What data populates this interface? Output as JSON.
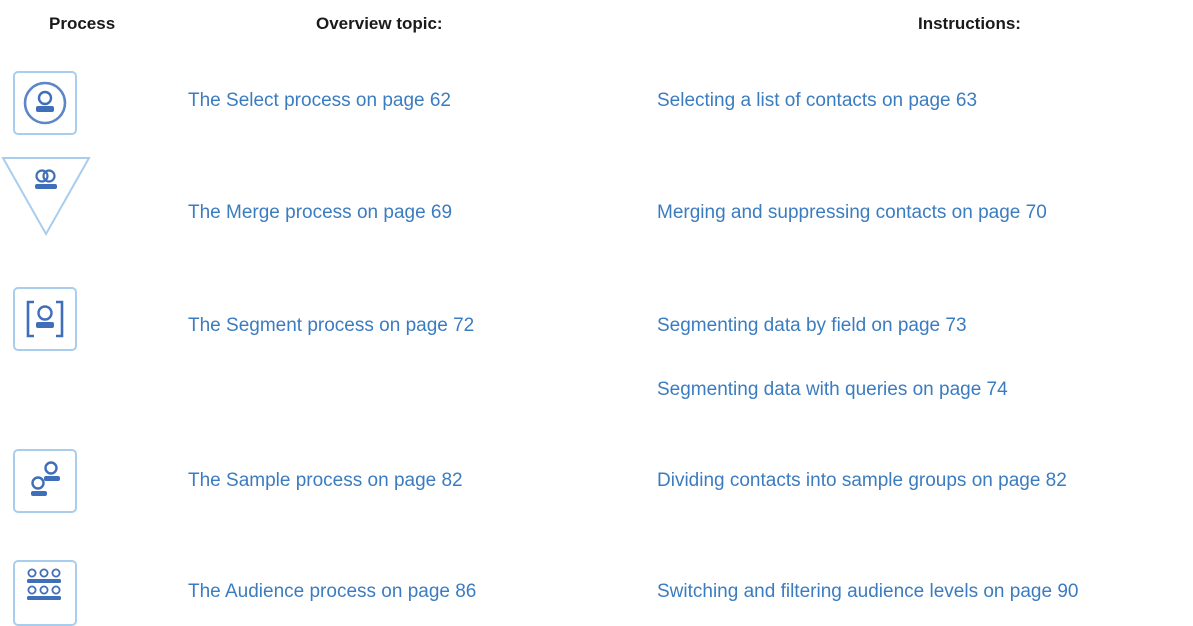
{
  "headers": {
    "process": "Process",
    "overview": "Overview topic:",
    "instructions": "Instructions:"
  },
  "rows": [
    {
      "icon": "select-process-icon",
      "overview": "The Select process on page 62",
      "instructions": [
        "Selecting a list of contacts on page 63"
      ]
    },
    {
      "icon": "merge-process-icon",
      "overview": "The Merge process on page 69",
      "instructions": [
        "Merging and suppressing contacts on page 70"
      ]
    },
    {
      "icon": "segment-process-icon",
      "overview": "The Segment process on page 72",
      "instructions": [
        "Segmenting data by field on page 73",
        "Segmenting data with queries on page 74"
      ]
    },
    {
      "icon": "sample-process-icon",
      "overview": "The Sample process on page 82",
      "instructions": [
        "Dividing contacts into sample groups on page 82"
      ]
    },
    {
      "icon": "audience-process-icon",
      "overview": "The Audience process on page 86",
      "instructions": [
        "Switching and filtering audience levels on page 90"
      ]
    }
  ],
  "colors": {
    "link": "#3b7cc0",
    "icon_border": "#a9cdec",
    "icon_stroke": "#5b86c7",
    "icon_fill": "#3f6fb8"
  }
}
